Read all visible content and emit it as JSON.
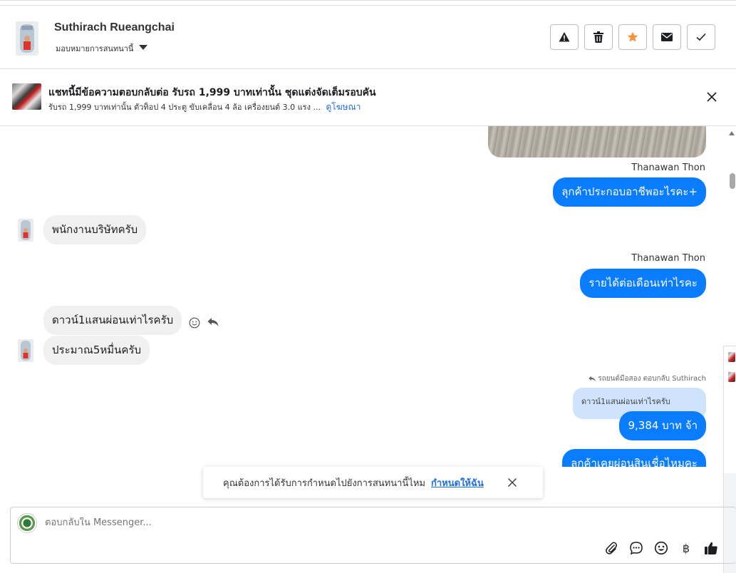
{
  "header": {
    "name": "Suthirach Rueangchai",
    "assign_label": "มอบหมายการสนทนานี้",
    "actions": [
      "spam-icon",
      "trash-icon",
      "star-icon",
      "mail-icon",
      "check-icon"
    ],
    "star_color": "#f7923b"
  },
  "ad": {
    "title": "แชทนี้มีข้อความตอบกลับต่อ รับรถ 1,999 บาทเท่านั้น ชุดแต่งจัดเต็มรอบคัน",
    "description": "รับรถ 1,999 บาทเท่านั้น ตัวท็อป 4 ประตู ขับเคลื่อน 4 ล้อ เครื่องยนต์ 3.0 แรง ...",
    "link": "ดูโฆษณา"
  },
  "messages": {
    "m1": {
      "sender": "Thanawan Thon",
      "text": "ลุกค้าประกอบอาชีพอะไรคะ+"
    },
    "m2": {
      "text": "พนักงานบริษัทครับ"
    },
    "m3": {
      "sender": "Thanawan Thon",
      "text": "รายได้ต่อเดือนเท่าไรคะ"
    },
    "m4": {
      "text": "ดาวน์1แสนผ่อนเท่าไรครับ"
    },
    "m5": {
      "text": "ประมาณ5หมื่นครับ"
    },
    "m6": {
      "reply_note": "รถยนต์มือสอง ตอบกลับ Suthirach",
      "quoted": "ดาวน์1แสนผ่อนเท่าไรครับ",
      "text": "9,384 บาท จ้า"
    },
    "m7": {
      "text": "ลูกค้าเคยผ่อนสินเชื่อไหมคะ"
    },
    "outgoing_color": "#0a7cff"
  },
  "toast": {
    "text": "คุณต้องการได้รับการกำหนดไปยังการสนทนานี้ไหม",
    "link": "กำหนดให้ฉัน"
  },
  "composer": {
    "placeholder": "ตอบกลับใน Messenger...",
    "baht_symbol": "฿"
  }
}
